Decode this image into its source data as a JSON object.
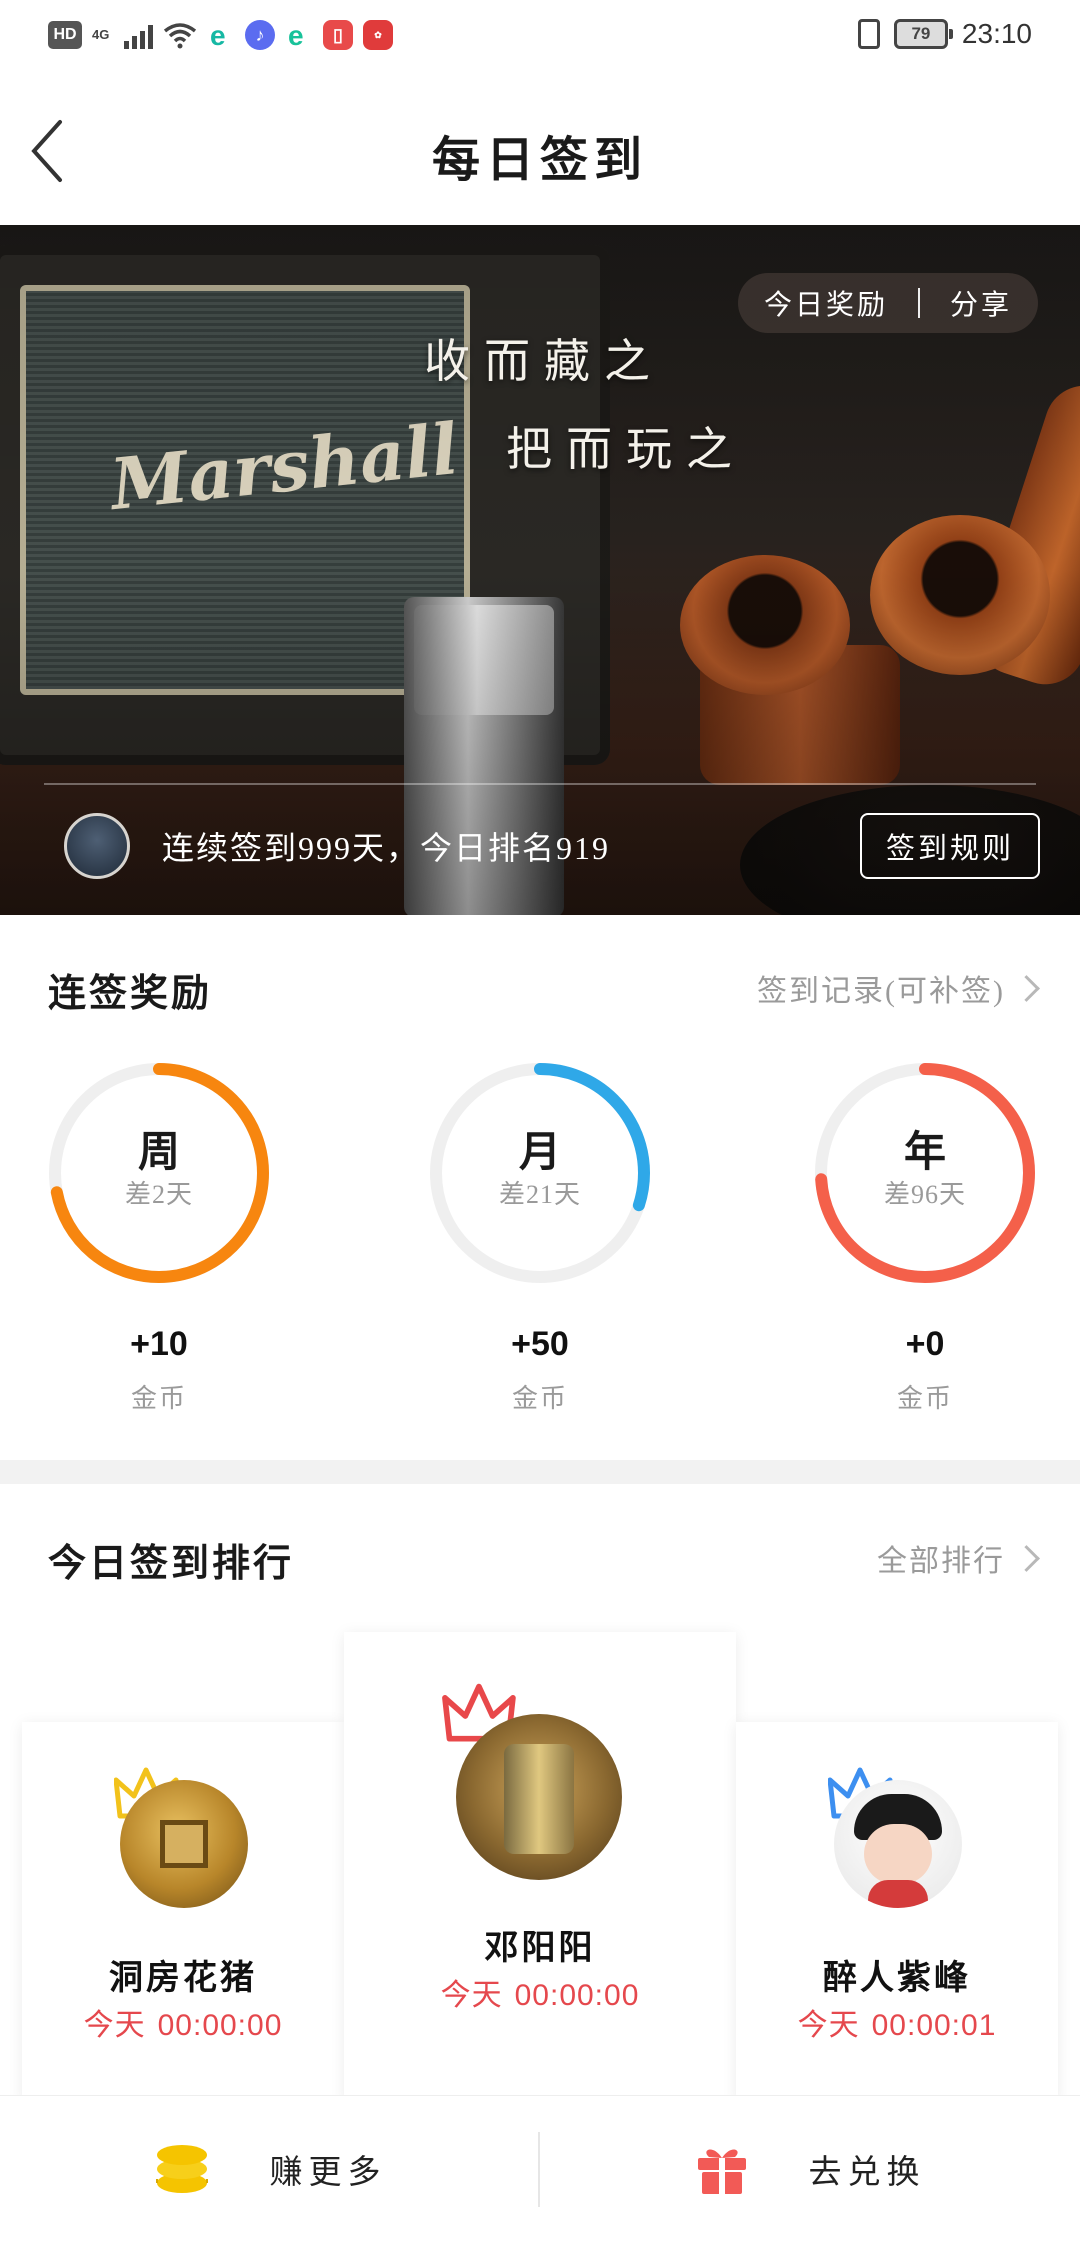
{
  "status_bar": {
    "hd": "HD",
    "network": "4G",
    "battery": "79",
    "time": "23:10",
    "icons": [
      "hd-icon",
      "signal-icon",
      "wifi-icon",
      "browser-e-icon",
      "music-icon",
      "browser-e-icon",
      "reader-icon",
      "huawei-store-icon",
      "vibrate-icon",
      "battery-icon"
    ]
  },
  "header": {
    "title": "每日签到",
    "back_icon": "chevron-left-icon"
  },
  "hero": {
    "reward_label": "今日奖励",
    "share_label": "分享",
    "slogan_line1": "收而藏之",
    "slogan_line2": "把而玩之",
    "streak_text": "连续签到999天，今日排名919",
    "rules_button": "签到规则"
  },
  "streak_rewards": {
    "title": "连签奖励",
    "record_link": "签到记录(可补签)",
    "rings": [
      {
        "label": "周",
        "sub": "差2天",
        "reward": "+10",
        "unit": "金币",
        "progress": 0.72,
        "color": "#f7860f"
      },
      {
        "label": "月",
        "sub": "差21天",
        "reward": "+50",
        "unit": "金币",
        "progress": 0.3,
        "color": "#2fa8e8"
      },
      {
        "label": "年",
        "sub": "差96天",
        "reward": "+0",
        "unit": "金币",
        "progress": 0.74,
        "color": "#f4604a"
      }
    ]
  },
  "ranking": {
    "title": "今日签到排行",
    "all_link": "全部排行",
    "today_label": "今天",
    "entries": [
      {
        "rank": 2,
        "name": "洞房花猪",
        "time": "00:00:00",
        "crown_color": "#f2c21b"
      },
      {
        "rank": 1,
        "name": "邓阳阳",
        "time": "00:00:00",
        "crown_color": "#e8484a"
      },
      {
        "rank": 3,
        "name": "醉人紫峰",
        "time": "00:00:01",
        "crown_color": "#3d8ff0"
      }
    ]
  },
  "bottom_bar": {
    "earn_label": "赚更多",
    "exchange_label": "去兑换",
    "earn_icon": "coins-icon",
    "exchange_icon": "gift-icon"
  },
  "colors": {
    "accent_red": "#e5484d",
    "orange": "#f7860f",
    "blue": "#2fa8e8",
    "coral": "#f4604a",
    "gold": "#f5c400"
  }
}
